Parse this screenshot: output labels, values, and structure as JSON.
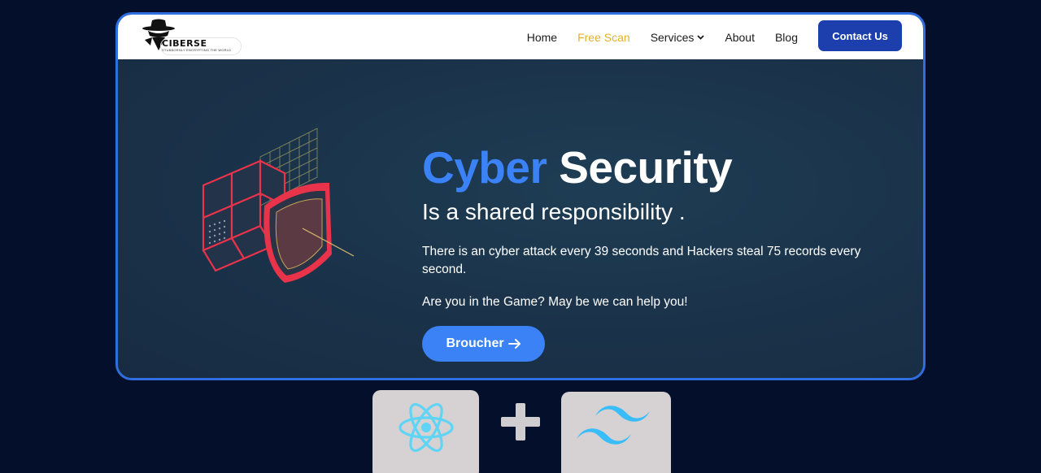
{
  "navbar": {
    "logo": {
      "brand": "CIBERSE",
      "tagline": "STUBBORNLY ENCRYPTING THE WORLD",
      "icon": "hat-detective-icon"
    },
    "links": [
      {
        "label": "Home",
        "active": false
      },
      {
        "label": "Free Scan",
        "active": true
      },
      {
        "label": "Services",
        "active": false,
        "has_dropdown": true
      },
      {
        "label": "About",
        "active": false
      },
      {
        "label": "Blog",
        "active": false
      }
    ],
    "contact_label": "Contact Us"
  },
  "hero": {
    "title_word1": "Cyber",
    "title_word2": "Security",
    "subtitle": "Is a shared responsibility .",
    "paragraph1": "There is an cyber attack every 39 seconds and Hackers steal 75 records every second.",
    "paragraph2": "Are you in the Game? May be we can help you!",
    "cta_label": "Broucher",
    "cta_icon": "arrow-right-icon",
    "illustration": "security-cube-shield-icon"
  },
  "tech_stack": {
    "items": [
      "react-logo-icon",
      "plus-icon",
      "tailwind-logo-icon"
    ]
  },
  "colors": {
    "background": "#04102b",
    "frame_border": "#2f6fe0",
    "accent_blue": "#3b82f6",
    "nav_active": "#e3b12e",
    "contact_button": "#1d3fae",
    "hero_bg": "#1a3348",
    "react_cyan": "#5fd4f4",
    "tailwind_teal": "#38bdf8"
  }
}
